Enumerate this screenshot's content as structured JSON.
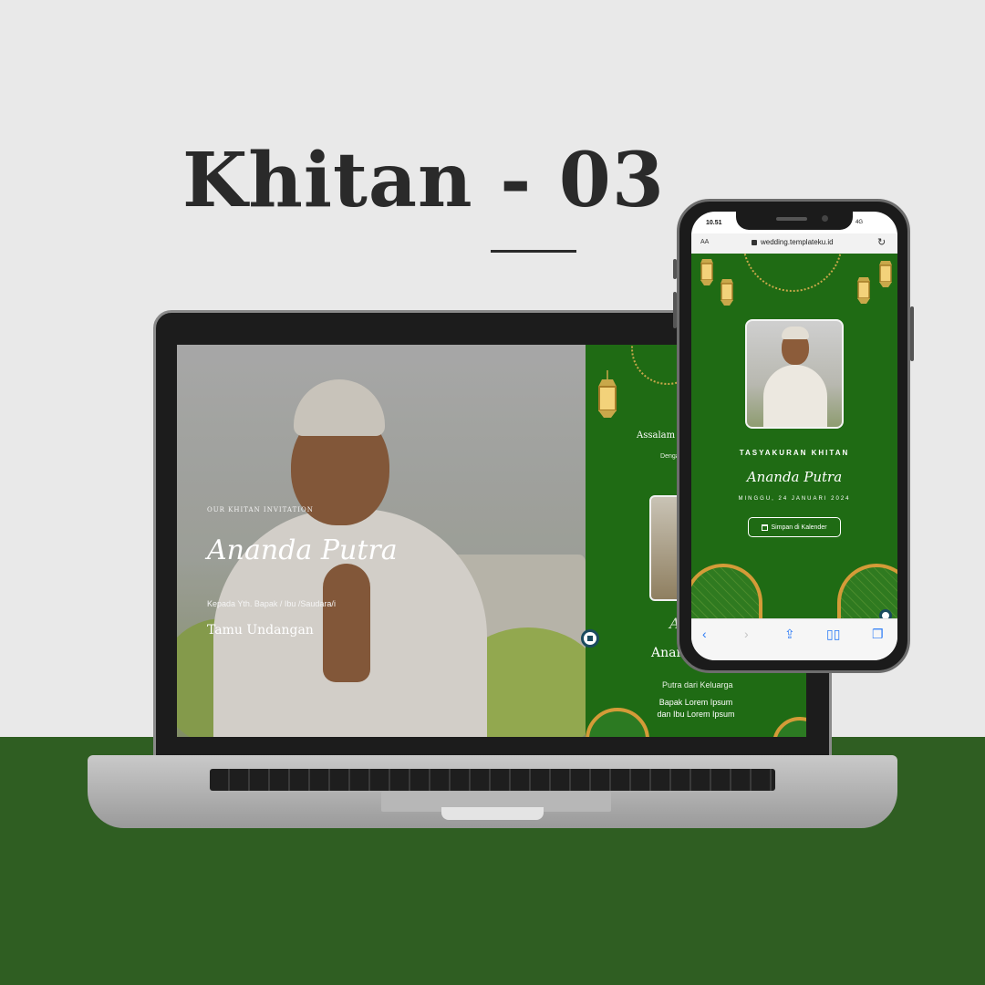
{
  "headline": {
    "title": "Khitan - 03"
  },
  "desktop_page": {
    "eyebrow": "OUR KHITAN INVITATION",
    "name": "Ananda Putra",
    "to_label": "Kepada Yth. Bapak / Ibu /Saudara/i",
    "guest": "Tamu Undangan",
    "right_panel": {
      "greeting": "Assalam",
      "intro_text": "Dengan mem Subhanahu Wa menyelenggarakan",
      "name_initial": "A",
      "name": "Anan",
      "parent_label": "Putra dari Keluarga",
      "parents": "Bapak Lorem Ipsum dan Ibu Lorem Ipsum"
    }
  },
  "phone": {
    "status_time": "10.51",
    "status_right": "4G",
    "url_aa": "AA",
    "url": "wedding.templateku.id",
    "page": {
      "title": "TASYAKURAN KHITAN",
      "name": "Ananda Putra",
      "date": "MINGGU, 24 JANUARI 2024",
      "calendar_button": "Simpan di Kalender"
    },
    "safari_icons": [
      "back-icon",
      "forward-icon",
      "share-icon",
      "bookmarks-icon",
      "tabs-icon"
    ]
  },
  "colors": {
    "brand_green": "#1f6b14",
    "floor_green": "#2f5e22",
    "gold": "#d49b38",
    "background": "#e9e9e9"
  }
}
